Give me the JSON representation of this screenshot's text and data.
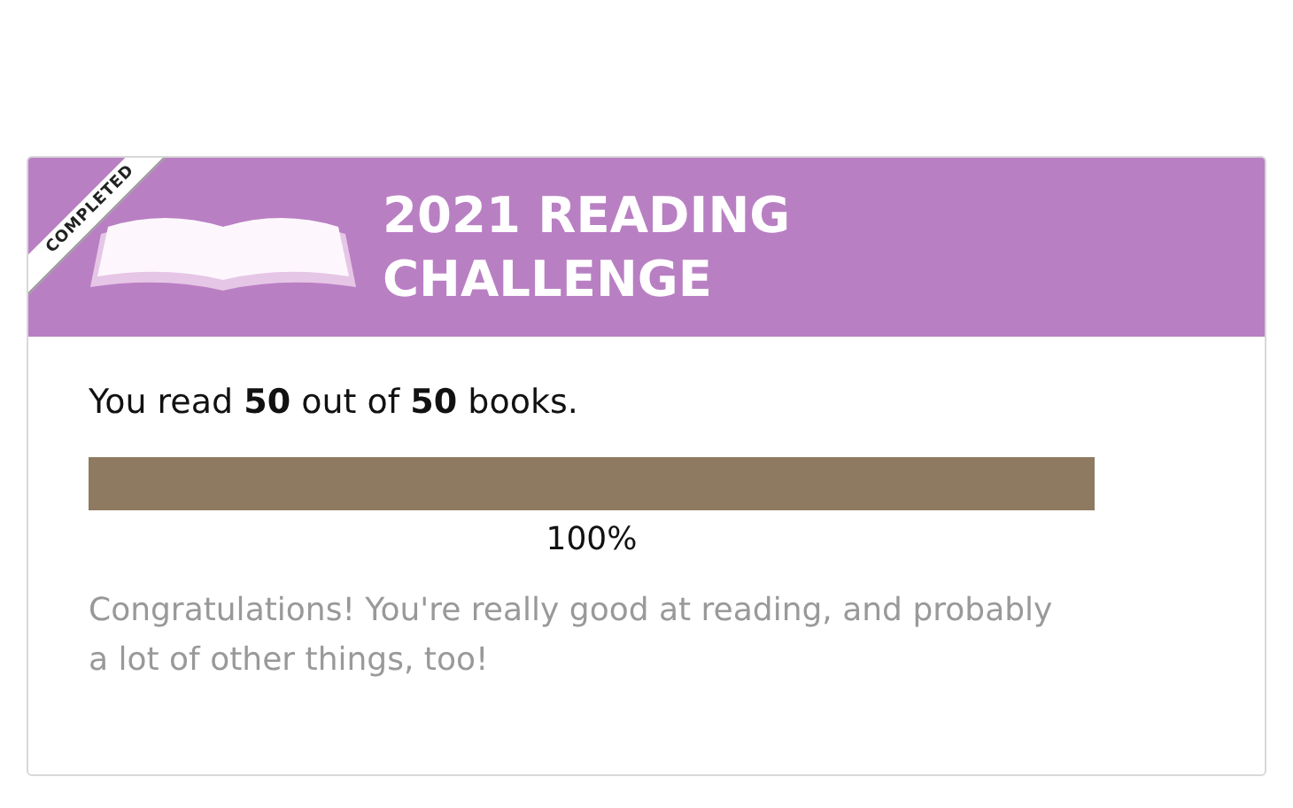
{
  "challenge": {
    "ribbon": "COMPLETED",
    "title": "2021 READING CHALLENGE",
    "summary": "You read **50** out of **50** books.",
    "progress": {
      "level": 1.0,
      "reading": "100%"
    },
    "message": "Congratulations! You're really good at reading, and probably a lot of other things, too!"
  }
}
